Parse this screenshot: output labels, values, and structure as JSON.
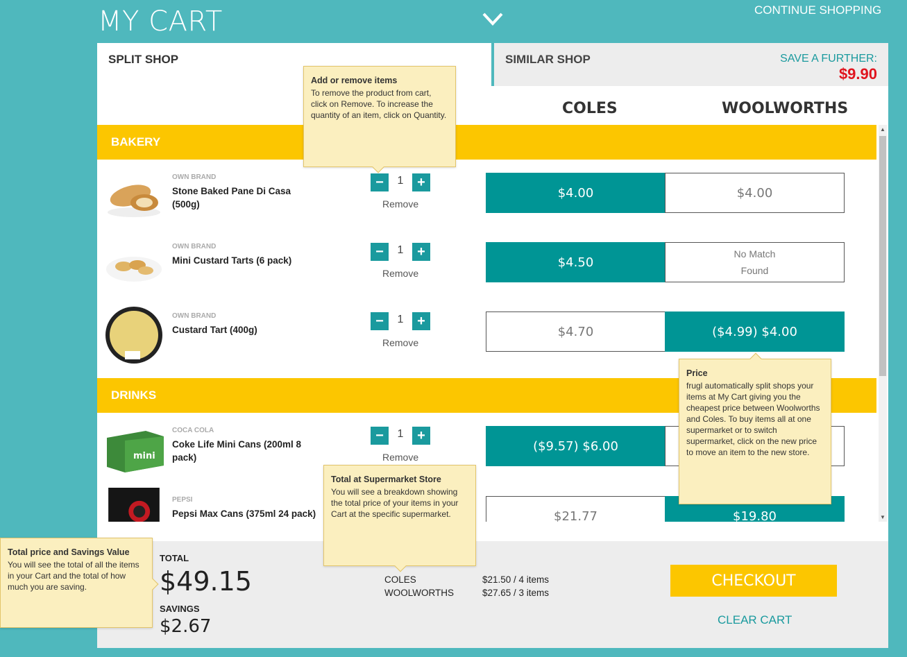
{
  "header": {
    "title": "MY CART",
    "continue_label": "CONTINUE SHOPPING"
  },
  "tabs": {
    "split_label": "SPLIT SHOP",
    "similar_label": "SIMILAR SHOP",
    "save_label": "SAVE A FURTHER:",
    "save_value": "$9.90"
  },
  "columns": {
    "coles": "COLES",
    "woolworths": "WOOLWORTHS"
  },
  "categories": {
    "bakery": "BAKERY",
    "drinks": "DRINKS"
  },
  "remove_label": "Remove",
  "items": [
    {
      "brand": "OWN BRAND",
      "name": "Stone Baked Pane Di Casa (500g)",
      "qty": "1",
      "coles": "$4.00",
      "woolworths": "$4.00",
      "selected": "coles"
    },
    {
      "brand": "OWN BRAND",
      "name": "Mini Custard Tarts (6 pack)",
      "qty": "1",
      "coles": "$4.50",
      "woolworths_line1": "No Match",
      "woolworths_line2": "Found",
      "selected": "coles"
    },
    {
      "brand": "OWN BRAND",
      "name": "Custard Tart (400g)",
      "qty": "1",
      "coles": "$4.70",
      "woolworths": "($4.99) $4.00",
      "selected": "woolworths"
    },
    {
      "brand": "COCA COLA",
      "name": "Coke Life Mini Cans (200ml 8 pack)",
      "qty": "1",
      "coles": "($9.57) $6.00",
      "selected": "coles"
    },
    {
      "brand": "PEPSI",
      "name": "Pepsi Max Cans (375ml 24 pack)",
      "coles": "$21.77",
      "woolworths": "$19.80",
      "selected": "woolworths"
    }
  ],
  "footer": {
    "total_label": "TOTAL",
    "total_value": "$49.15",
    "savings_label": "SAVINGS",
    "savings_value": "$2.67",
    "breakdown": [
      {
        "store": "COLES",
        "value": "$21.50 / 4 items"
      },
      {
        "store": "WOOLWORTHS",
        "value": "$27.65 / 3 items"
      }
    ],
    "checkout_label": "CHECKOUT",
    "clear_label": "CLEAR CART"
  },
  "tooltips": {
    "add_remove": {
      "title": "Add or remove items",
      "body": "To remove the product from cart, click on Remove. To increase the quantity of an item, click on Quantity."
    },
    "price": {
      "title": "Price",
      "body": "frugl automatically split shops your items at My Cart giving you the cheapest price between Woolworths and Coles. To buy items all at one supermarket or to switch supermarket, click on the new price to move an item to the new store."
    },
    "total_store": {
      "title": "Total at Supermarket Store",
      "body": "You will see a breakdown showing the total price of your items in your Cart at the specific supermarket."
    },
    "total_savings": {
      "title": "Total price and Savings Value",
      "body": "You will see the total of all the items in your Cart and the total of how much you are saving."
    }
  },
  "colors": {
    "accent": "#1a9a9e",
    "selected": "#009595",
    "category": "#fcc600",
    "save": "#e0141e",
    "background": "#4fb8bd"
  }
}
